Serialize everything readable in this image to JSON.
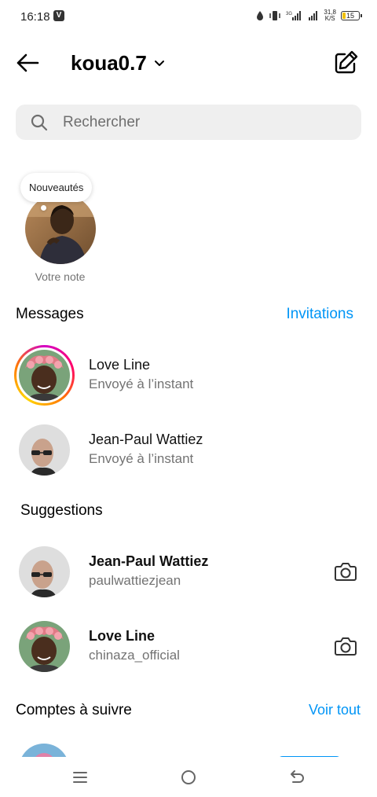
{
  "status_bar": {
    "time": "16:18",
    "vpn_badge": "V",
    "network_speed": "31,8\nK/S",
    "battery": "15",
    "icons": [
      "water-drop-icon",
      "vibrate-icon",
      "signal-3g-icon",
      "signal-icon"
    ]
  },
  "header": {
    "account_name": "koua0.7",
    "back_icon": "arrow-left-icon",
    "compose_icon": "compose-edit-icon",
    "dropdown_icon": "chevron-down-icon"
  },
  "search": {
    "placeholder": "Rechercher"
  },
  "note": {
    "bubble_text": "Nouveautés",
    "label": "Votre note"
  },
  "messages": {
    "title": "Messages",
    "link": "Invitations",
    "items": [
      {
        "name": "Love Line",
        "subtitle": "Envoyé à l’instant",
        "has_story": true
      },
      {
        "name": "Jean-Paul Wattiez",
        "subtitle": "Envoyé à l’instant",
        "has_story": false
      }
    ]
  },
  "suggestions": {
    "title": "Suggestions",
    "items": [
      {
        "name": "Jean-Paul Wattiez",
        "subtitle": "paulwattiezjean",
        "action_icon": "camera-icon"
      },
      {
        "name": "Love Line",
        "subtitle": "chinaza_official",
        "action_icon": "camera-icon"
      }
    ]
  },
  "accounts": {
    "title": "Comptes à suivre",
    "link": "Voir tout"
  },
  "nav": {
    "icons": [
      "menu-icon",
      "home-circle-icon",
      "back-nav-icon"
    ]
  },
  "colors": {
    "accent": "#0095f6",
    "secondary_text": "#737373",
    "search_bg": "#efefef"
  }
}
